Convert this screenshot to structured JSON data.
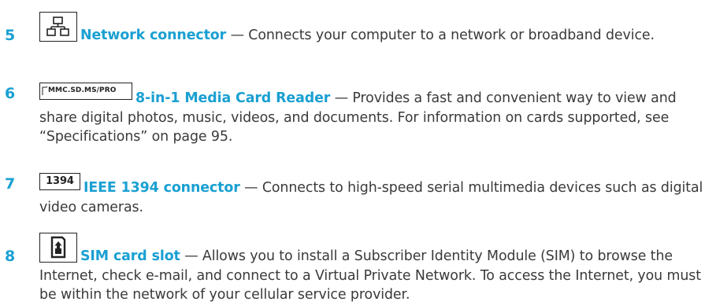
{
  "colors": {
    "accent": "#1aa0d2",
    "text": "#3a3a3a"
  },
  "items": [
    {
      "number": "5",
      "icon": "network-connector-icon",
      "title": "Network connector",
      "description": " — Connects your computer to a network or broadband device."
    },
    {
      "number": "6",
      "icon": "media-card-reader-icon",
      "icon_text": "MMC.SD.MS/PRO",
      "title": "8-in-1 Media Card Reader",
      "description": " — Provides a fast and convenient way to view and share digital photos, music, videos, and documents. For information on cards supported, see “Specifications” on page 95."
    },
    {
      "number": "7",
      "icon": "ieee-1394-icon",
      "icon_text": "1394",
      "title": "IEEE 1394 connector",
      "description": " — Connects to high-speed serial multimedia devices such as digital video cameras."
    },
    {
      "number": "8",
      "icon": "sim-card-icon",
      "title": "SIM card slot",
      "description": " — Allows you to install a Subscriber Identity Module (SIM) to browse the Internet, check e-mail, and connect to a Virtual Private Network. To access the Internet, you must be within the network of your cellular service provider."
    }
  ]
}
